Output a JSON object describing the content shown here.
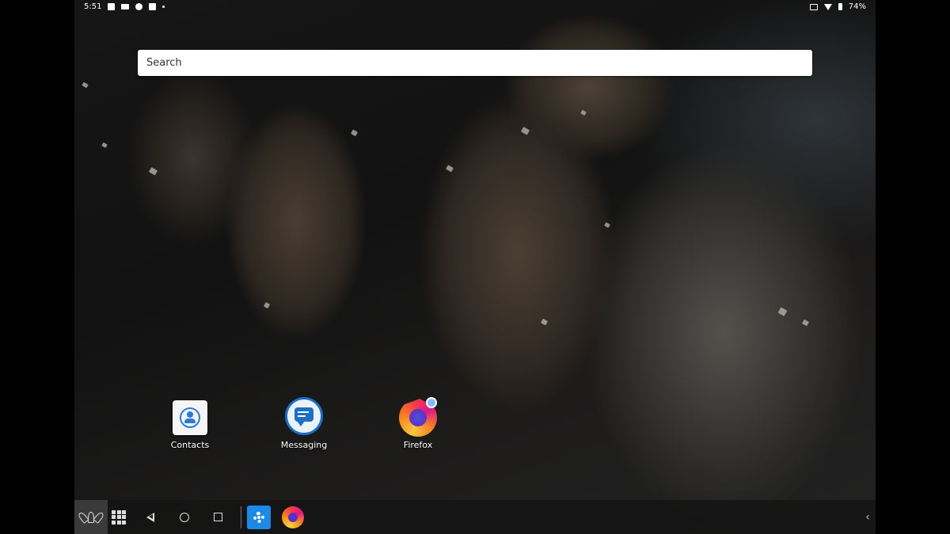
{
  "status_bar": {
    "time": "5:51",
    "left_icons": [
      "image-icon",
      "camera-icon",
      "firefox-notification-icon",
      "clapper-icon",
      "dot-icon"
    ],
    "right_icons": [
      "cast-icon",
      "wifi-icon",
      "battery-icon"
    ],
    "battery": "74%"
  },
  "search": {
    "placeholder": "Search"
  },
  "apps": [
    {
      "label": "Contacts",
      "icon": "contacts-icon"
    },
    {
      "label": "Messaging",
      "icon": "messaging-icon"
    },
    {
      "label": "Firefox",
      "icon": "firefox-icon"
    }
  ],
  "taskbar": {
    "start": "lotus-icon",
    "app_drawer": "grid-icon",
    "nav": [
      "back-icon",
      "home-icon",
      "recents-icon"
    ],
    "pinned": [
      "settings-icon",
      "firefox-icon"
    ],
    "overflow": "‹"
  }
}
